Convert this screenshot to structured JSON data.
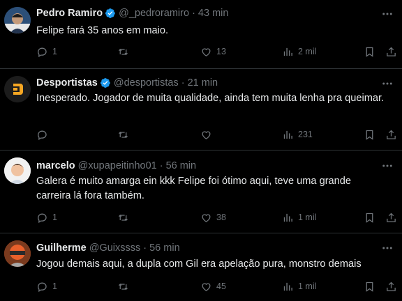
{
  "tweets": [
    {
      "name": "Pedro Ramiro",
      "verified": true,
      "handle": "@_pedroramiro",
      "time": "43 min",
      "text": "Felipe fará 35 anos em maio.",
      "replies": "1",
      "retweets": "",
      "likes": "13",
      "views": "2 mil"
    },
    {
      "name": "Desportistas",
      "verified": true,
      "handle": "@desportistas",
      "time": "21 min",
      "text": "Inesperado. Jogador de muita qualidade, ainda  tem muita lenha pra queimar.",
      "replies": "",
      "retweets": "",
      "likes": "",
      "views": "231"
    },
    {
      "name": "marcelo",
      "verified": false,
      "handle": "@xupapeitinho01",
      "time": "56 min",
      "text": "Galera é muito amarga ein kkk Felipe foi ótimo aqui, teve uma grande carreira lá fora também.",
      "replies": "1",
      "retweets": "",
      "likes": "38",
      "views": "1 mil"
    },
    {
      "name": "Guilherme",
      "verified": false,
      "handle": "@Guixssss",
      "time": "56 min",
      "text": "Jogou demais aqui, a dupla com Gil era apelação pura, monstro demais",
      "replies": "1",
      "retweets": "",
      "likes": "45",
      "views": "1 mil"
    }
  ],
  "dot": "·",
  "colors": {
    "background": "#000000",
    "text": "#e7e9ea",
    "muted": "#71767b",
    "verified": "#1d9bf0",
    "divider": "#2f3336"
  },
  "icons": {
    "reply": "reply-icon",
    "retweet": "retweet-icon",
    "like": "like-icon",
    "views": "views-icon",
    "bookmark": "bookmark-icon",
    "share": "share-icon",
    "more": "more-icon",
    "verified": "verified-badge-icon"
  }
}
